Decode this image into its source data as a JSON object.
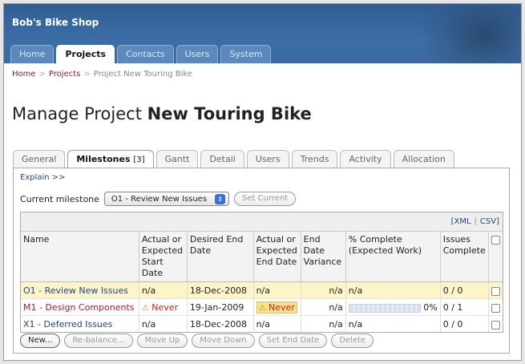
{
  "app": {
    "brand": "Bob's Bike Shop"
  },
  "nav": {
    "tabs": [
      "Home",
      "Projects",
      "Contacts",
      "Users",
      "System"
    ],
    "active": "Projects"
  },
  "breadcrumb": {
    "home": "Home",
    "projects": "Projects",
    "current": "Project New Touring Bike",
    "sep": ">"
  },
  "page": {
    "title_prefix": "Manage Project",
    "title_name": "New Touring Bike"
  },
  "subtabs": {
    "items": [
      "General",
      "Milestones",
      "Gantt",
      "Detail",
      "Users",
      "Trends",
      "Activity",
      "Allocation"
    ],
    "milestones_count": "[3]",
    "active": "Milestones"
  },
  "milestones": {
    "explain": "Explain >>",
    "current_label": "Current milestone",
    "current_value": "O1 - Review New Issues",
    "set_current": "Set Current",
    "export_xml": "XML",
    "export_csv": "CSV",
    "columns": [
      "Name",
      "Actual or Expected Start Date",
      "Desired End Date",
      "Actual or Expected End Date",
      "End Date Variance",
      "% Complete (Expected Work)",
      "Issues Complete"
    ],
    "rows": [
      {
        "name": "O1 - Review New Issues",
        "start": "n/a",
        "desired_end": "18-Dec-2008",
        "actual_end": "n/a",
        "variance": "n/a",
        "complete": "n/a",
        "issues": "0 / 0"
      },
      {
        "name": "M1 - Design Components",
        "start": "Never",
        "desired_end": "19-Jan-2009",
        "actual_end": "Never",
        "variance": "n/a",
        "complete": "0%",
        "progress_fraction": 0.0,
        "issues": "0 / 1"
      },
      {
        "name": "X1 - Deferred Issues",
        "start": "n/a",
        "desired_end": "18-Dec-2008",
        "actual_end": "n/a",
        "variance": "n/a",
        "complete": "n/a",
        "issues": "0 / 0"
      }
    ],
    "buttons": {
      "new": "New...",
      "rebalance": "Re-balance...",
      "move_up": "Move Up",
      "move_down": "Move Down",
      "set_end_date": "Set End Date",
      "delete": "Delete"
    }
  },
  "colors": {
    "header": "#3a6aa0",
    "link": "#24438a",
    "highlight_row": "#fbf5c8",
    "breadcrumb_link": "#8b1a3a"
  }
}
